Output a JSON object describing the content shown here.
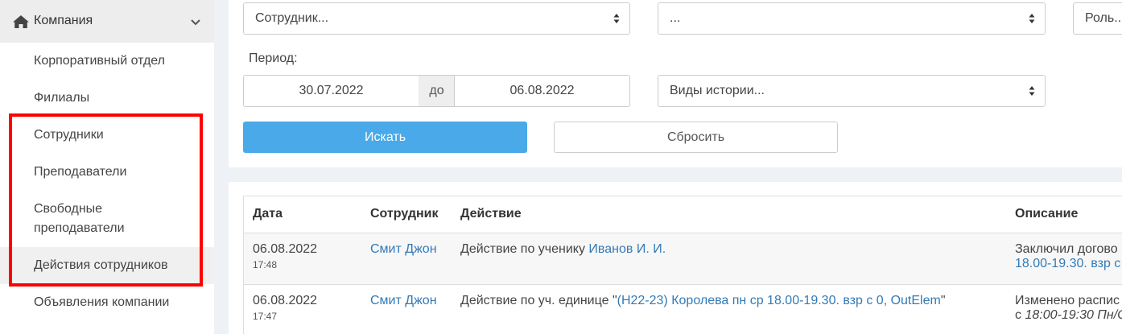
{
  "sidebar": {
    "header": "Компания",
    "items": [
      {
        "label": "Корпоративный отдел"
      },
      {
        "label": "Филиалы"
      },
      {
        "label": "Сотрудники"
      },
      {
        "label": "Преподаватели"
      },
      {
        "label": "Свободные преподаватели"
      },
      {
        "label": "Действия сотрудников"
      },
      {
        "label": "Объявления компании"
      }
    ]
  },
  "filters": {
    "employee_select": "Сотрудник...",
    "second_select": "...",
    "role_select": "Роль...",
    "period_label": "Период:",
    "date_from": "30.07.2022",
    "date_sep": "до",
    "date_to": "06.08.2022",
    "history_types": "Виды истории...",
    "search_button": "Искать",
    "reset_button": "Сбросить"
  },
  "table": {
    "headers": {
      "date": "Дата",
      "employee": "Сотрудник",
      "action": "Действие",
      "description": "Описание"
    },
    "rows": [
      {
        "date": "06.08.2022",
        "time": "17:48",
        "employee": "Смит Джон",
        "action_prefix": "Действие по ученику ",
        "action_link": "Иванов И. И.",
        "action_suffix": "",
        "desc_line1": "Заключил догово",
        "desc_line2": "18.00-19.30. взр с"
      },
      {
        "date": "06.08.2022",
        "time": "17:47",
        "employee": "Смит Джон",
        "action_prefix": "Действие по уч. единице \"",
        "action_link": "(Н22-23) Королева пн ср 18.00-19.30. взр с 0, OutElem",
        "action_suffix": "\"",
        "desc_line1": "Изменено распис",
        "desc_line2_prefix": "с ",
        "desc_line2_italic": "18:00-19:30 Пн/С"
      }
    ]
  },
  "colors": {
    "accent": "#4aa9e9",
    "link": "#337ab7",
    "highlight_box": "#ff0000"
  }
}
